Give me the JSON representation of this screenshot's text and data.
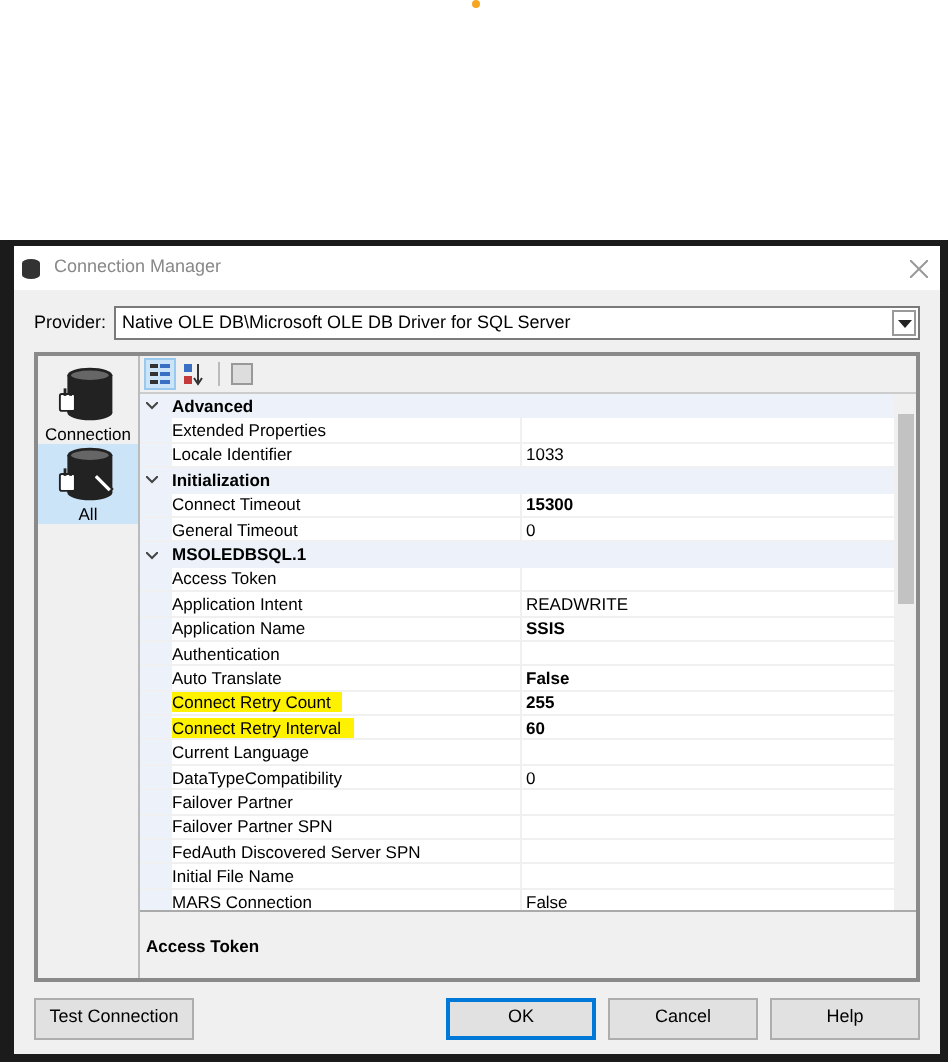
{
  "window": {
    "title": "Connection Manager"
  },
  "provider": {
    "label": "Provider:",
    "value": "Native OLE DB\\Microsoft OLE DB Driver for SQL Server"
  },
  "pages": [
    {
      "label": "Connection",
      "selected": false
    },
    {
      "label": "All",
      "selected": true
    }
  ],
  "toolbar": [
    {
      "kind": "categorized",
      "selected": true
    },
    {
      "kind": "alphabetical",
      "selected": false
    },
    {
      "kind": "pages",
      "selected": false
    }
  ],
  "categories": [
    {
      "name": "Advanced",
      "expanded": true,
      "properties": [
        {
          "name": "Extended Properties",
          "highlighted": false
        },
        {
          "name": "Locale Identifier",
          "value": "1033",
          "modified": false,
          "highlighted": false
        }
      ]
    },
    {
      "name": "Initialization",
      "expanded": true,
      "properties": [
        {
          "name": "Connect Timeout",
          "value": "15300",
          "modified": true,
          "highlighted": false
        },
        {
          "name": "General Timeout",
          "value": "0",
          "modified": false,
          "highlighted": false
        }
      ]
    },
    {
      "name": "MSOLEDBSQL.1",
      "expanded": true,
      "properties": [
        {
          "name": "Access Token",
          "highlighted": false
        },
        {
          "name": "Application Intent",
          "value": "READWRITE",
          "modified": false,
          "highlighted": false
        },
        {
          "name": "Application Name",
          "value": "SSIS",
          "modified": true,
          "highlighted": false
        },
        {
          "name": "Authentication",
          "highlighted": false
        },
        {
          "name": "Auto Translate",
          "value": "False",
          "modified": true,
          "highlighted": false
        },
        {
          "name": "Connect Retry Count",
          "value": "255",
          "modified": true,
          "highlighted": true
        },
        {
          "name": "Connect Retry Interval",
          "value": "60",
          "modified": true,
          "highlighted": true
        },
        {
          "name": "Current Language",
          "highlighted": false
        },
        {
          "name": "DataTypeCompatibility",
          "value": "0",
          "modified": false,
          "highlighted": false
        },
        {
          "name": "Failover Partner",
          "highlighted": false
        },
        {
          "name": "Failover Partner SPN",
          "highlighted": false
        },
        {
          "name": "FedAuth Discovered Server SPN",
          "highlighted": false
        },
        {
          "name": "Initial File Name",
          "highlighted": false
        },
        {
          "name": "MARS Connection",
          "value": "False",
          "modified": false,
          "highlighted": false
        }
      ]
    }
  ],
  "description": {
    "title": "Access Token"
  },
  "buttons": [
    {
      "label": "Test Connection",
      "kind": "left",
      "default": false
    },
    {
      "label": "OK",
      "kind": "right",
      "default": true
    },
    {
      "label": "Cancel",
      "kind": "right",
      "default": false
    },
    {
      "label": "Help",
      "kind": "right",
      "default": false
    }
  ]
}
